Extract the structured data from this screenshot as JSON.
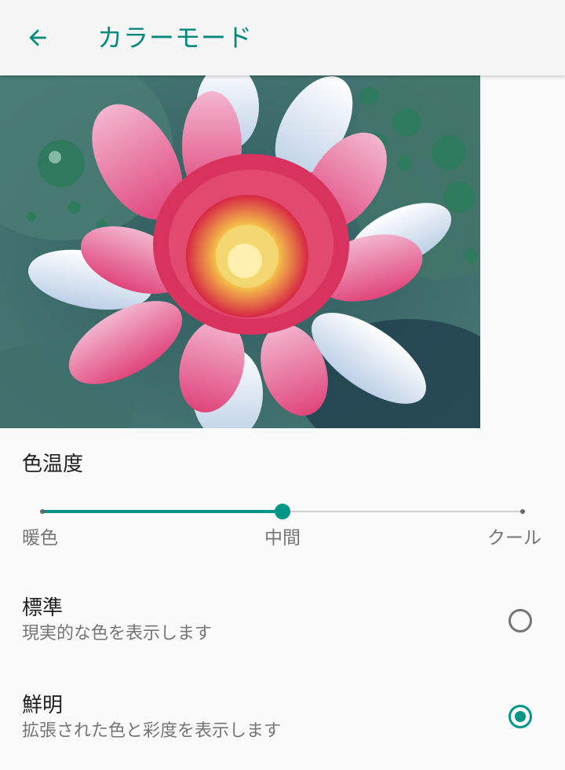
{
  "header": {
    "back_icon": "arrow-left-icon",
    "title": "カラーモード"
  },
  "preview": {
    "description_icon": "lotus-flower-image"
  },
  "color_temperature": {
    "label": "色温度",
    "min_label": "暖色",
    "mid_label": "中間",
    "max_label": "クール",
    "value": 0.5
  },
  "modes": [
    {
      "title": "標準",
      "subtitle": "現実的な色を表示します",
      "selected": false
    },
    {
      "title": "鮮明",
      "subtitle": "拡張された色と彩度を表示します",
      "selected": true
    }
  ],
  "colors": {
    "accent": "#009688",
    "title": "#00897b"
  }
}
